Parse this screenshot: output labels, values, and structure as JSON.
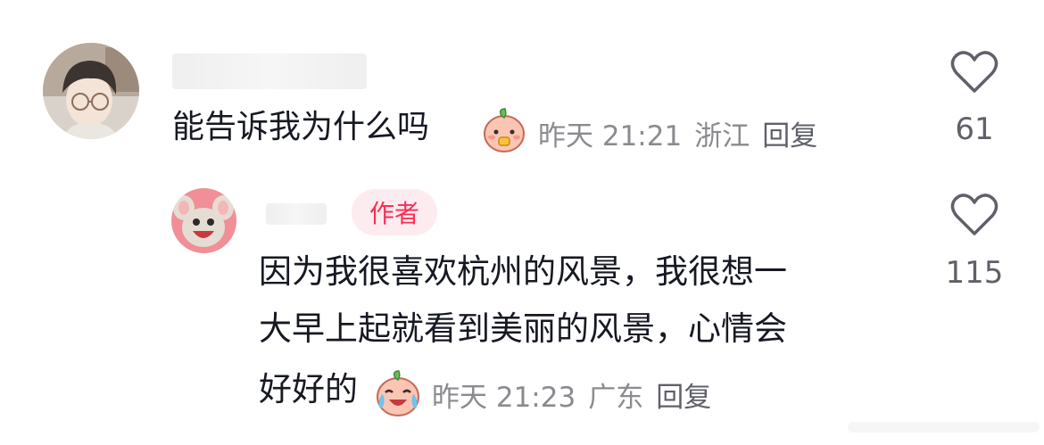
{
  "comment": {
    "text": "能告诉我为什么吗",
    "emoji": "peach-eating-emoji",
    "time": "昨天 21:21",
    "location": "浙江",
    "reply_label": "回复",
    "likes": "61",
    "colors": {
      "text": "#161823",
      "meta": "#8a8b91",
      "like_icon": "#5f606a"
    }
  },
  "reply": {
    "author_badge": "作者",
    "lines": [
      "因为我很喜欢杭州的风景，我很想一",
      "大早上起就看到美丽的风景，心情会",
      "好好的"
    ],
    "emoji": "peach-crying-laughing-emoji",
    "time": "昨天 21:23",
    "location": "广东",
    "reply_label": "回复",
    "likes": "115",
    "colors": {
      "badge_bg": "#fdecef",
      "badge_text": "#fe2c55"
    }
  }
}
